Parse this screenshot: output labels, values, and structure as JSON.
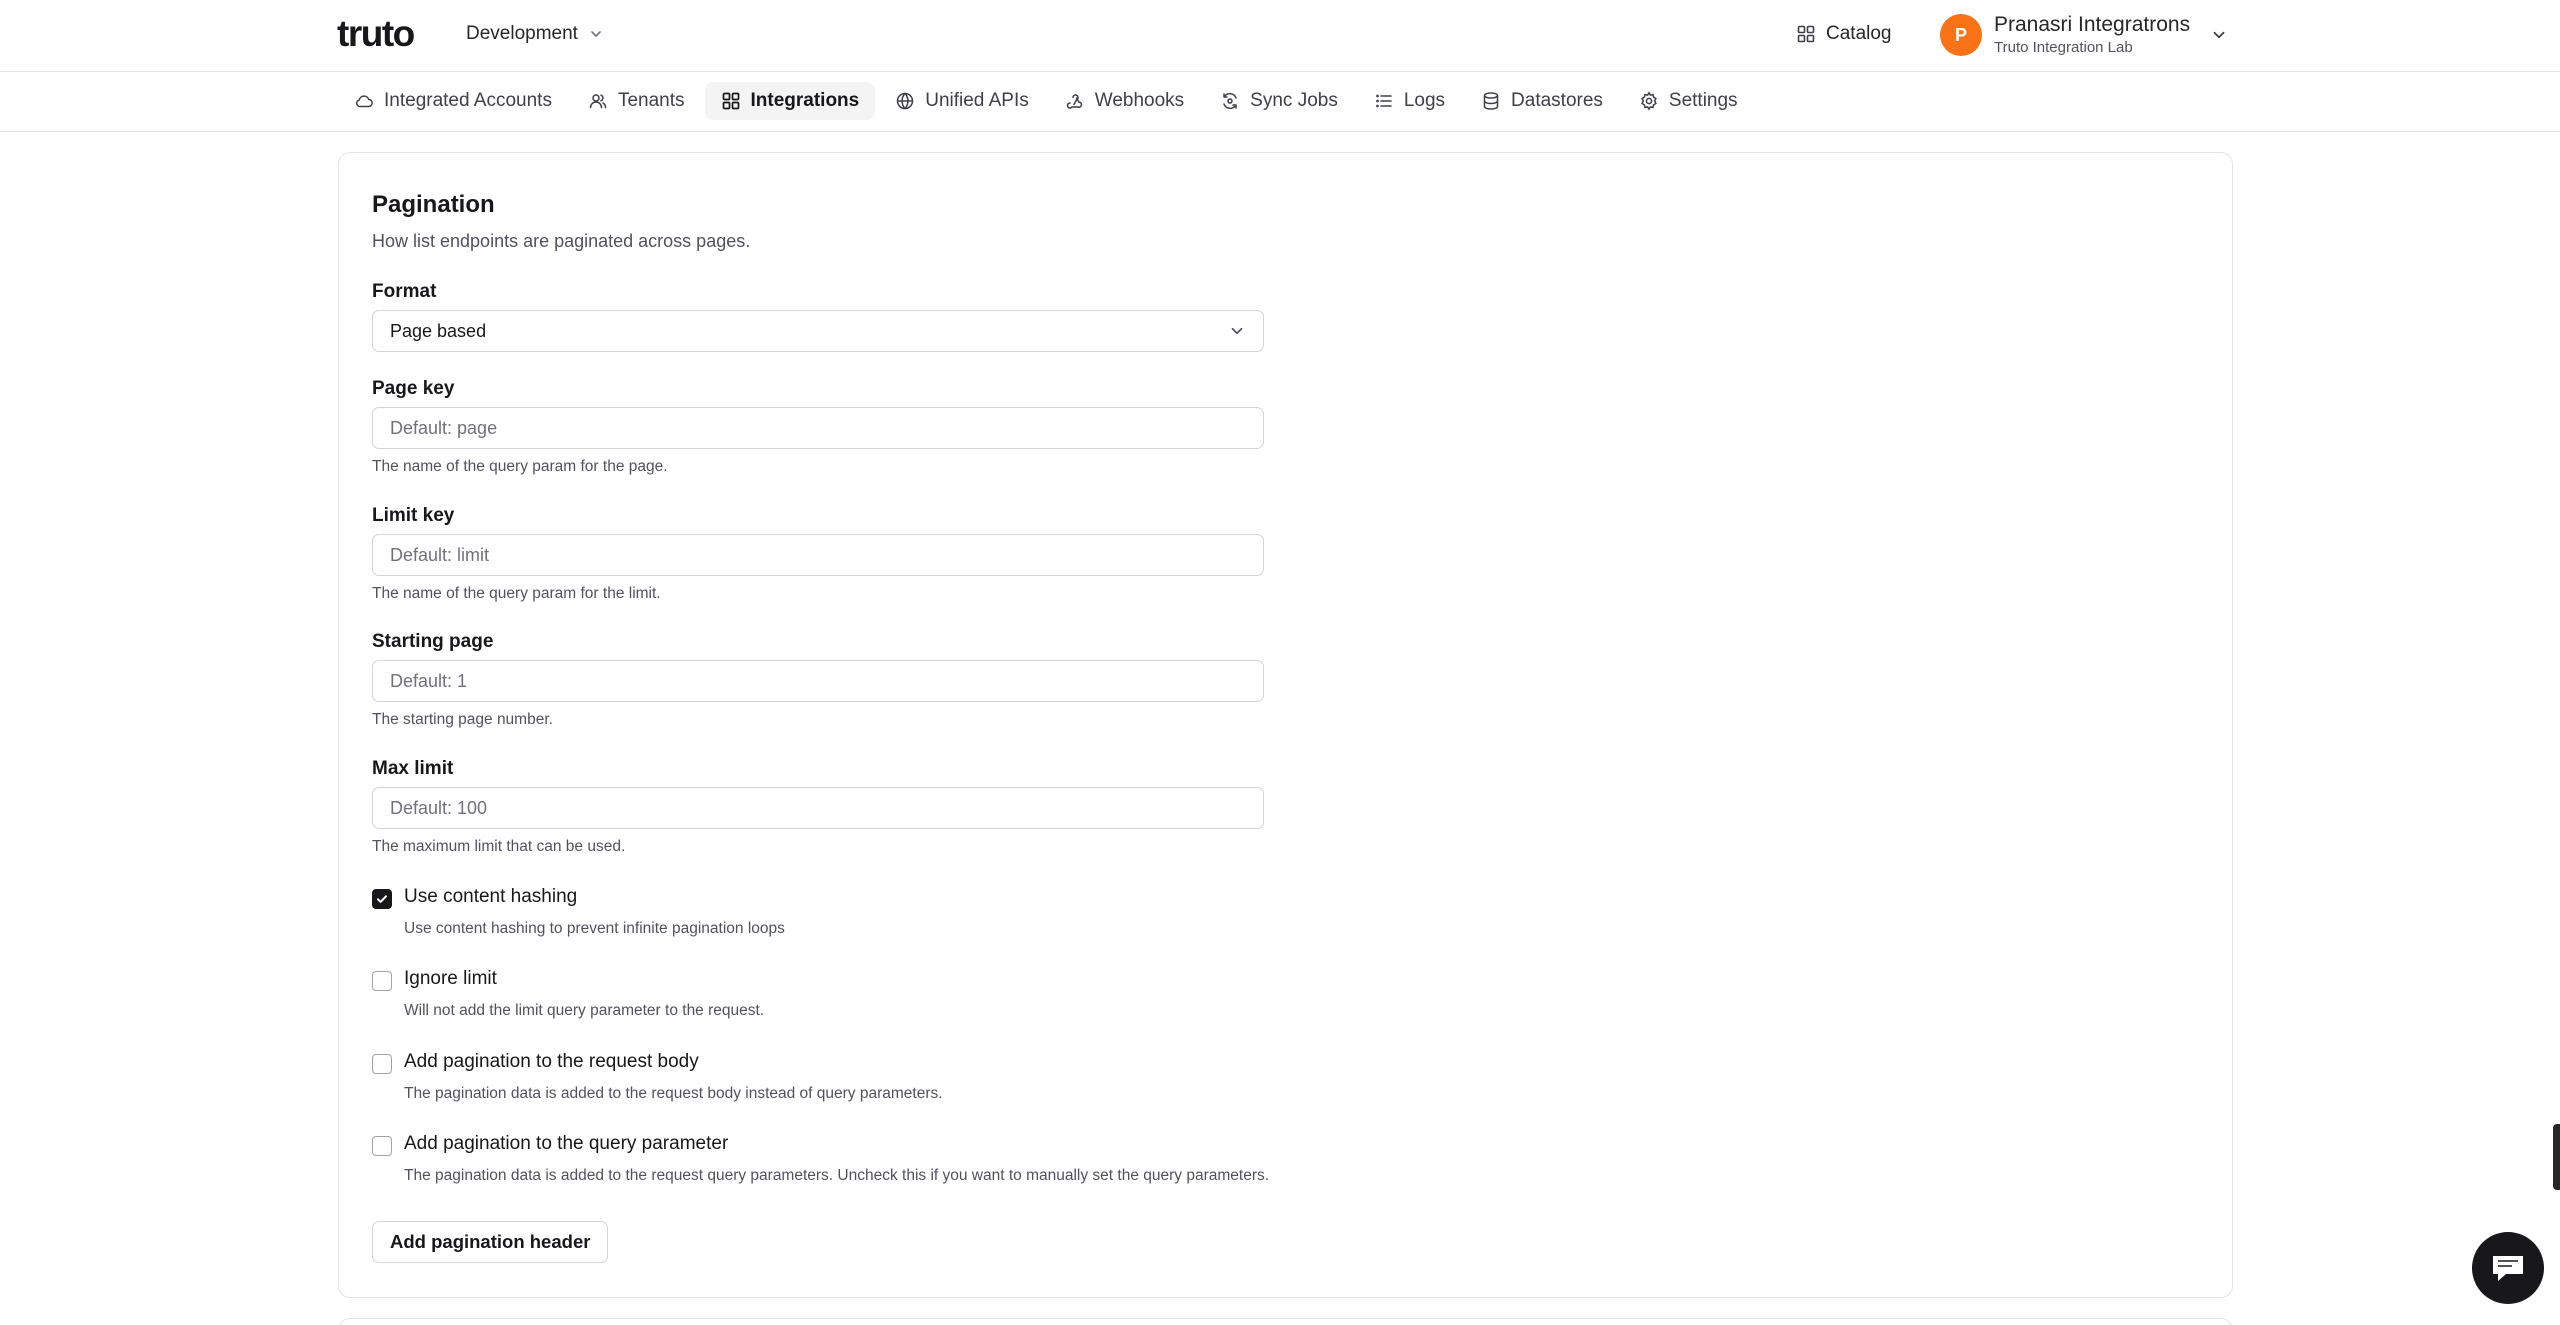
{
  "header": {
    "logo_text": "truto",
    "environment": "Development",
    "catalog_label": "Catalog",
    "user": {
      "initial": "P",
      "name": "Pranasri Integratrons",
      "org": "Truto Integration Lab"
    }
  },
  "nav": {
    "tabs": [
      {
        "label": "Integrated Accounts",
        "icon": "cloud-icon",
        "active": false
      },
      {
        "label": "Tenants",
        "icon": "users-icon",
        "active": false
      },
      {
        "label": "Integrations",
        "icon": "grid-icon",
        "active": true
      },
      {
        "label": "Unified APIs",
        "icon": "globe-icon",
        "active": false
      },
      {
        "label": "Webhooks",
        "icon": "webhook-icon",
        "active": false
      },
      {
        "label": "Sync Jobs",
        "icon": "sync-icon",
        "active": false
      },
      {
        "label": "Logs",
        "icon": "list-icon",
        "active": false
      },
      {
        "label": "Datastores",
        "icon": "database-icon",
        "active": false
      },
      {
        "label": "Settings",
        "icon": "gear-icon",
        "active": false
      }
    ]
  },
  "pagination": {
    "title": "Pagination",
    "description": "How list endpoints are paginated across pages.",
    "format": {
      "label": "Format",
      "value": "Page based"
    },
    "page_key": {
      "label": "Page key",
      "placeholder": "Default: page",
      "help": "The name of the query param for the page."
    },
    "limit_key": {
      "label": "Limit key",
      "placeholder": "Default: limit",
      "help": "The name of the query param for the limit."
    },
    "starting_page": {
      "label": "Starting page",
      "placeholder": "Default: 1",
      "help": "The starting page number."
    },
    "max_limit": {
      "label": "Max limit",
      "placeholder": "Default: 100",
      "help": "The maximum limit that can be used."
    },
    "options": [
      {
        "label": "Use content hashing",
        "help": "Use content hashing to prevent infinite pagination loops",
        "checked": true
      },
      {
        "label": "Ignore limit",
        "help": "Will not add the limit query parameter to the request.",
        "checked": false
      },
      {
        "label": "Add pagination to the request body",
        "help": "The pagination data is added to the request body instead of query parameters.",
        "checked": false
      },
      {
        "label": "Add pagination to the query parameter",
        "help": "The pagination data is added to the request query parameters. Uncheck this if you want to manually set the query parameters.",
        "checked": false
      }
    ],
    "add_header_button": "Add pagination header"
  },
  "colors": {
    "accent": "#18181b",
    "avatar": "#f97316",
    "border": "#e4e4e7"
  }
}
